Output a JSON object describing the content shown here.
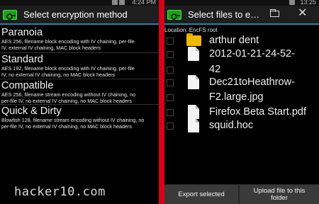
{
  "left": {
    "status_time": "4:24 PM",
    "title": "Select encryption method",
    "methods": [
      {
        "name": "Paranoia",
        "desc": [
          "AES 256, filename block encoding with IV chaining, per-file",
          "IV, external IV chaining, MAC block headers"
        ]
      },
      {
        "name": "Standard",
        "desc": [
          "AES 192, filename block encoding with IV chaining, per-file",
          "IV, no external IV chaining, no MAC block headers"
        ]
      },
      {
        "name": "Compatible",
        "desc": [
          "AES 256, filename stream encoding without IV chaining, no",
          "per-file IV, no external IV chaining, no MAC block headers"
        ]
      },
      {
        "name": "Quick & Dirty",
        "desc": [
          "Blowfish 128, filename stream encoding without IV chaining, no",
          "per-file IV, no external IV chaining, no MAC block headers"
        ]
      }
    ],
    "watermark": "hacker10.com"
  },
  "right": {
    "status_time": "13:25",
    "title": "Select files to e…",
    "location": "Location: EncFS root",
    "items": [
      {
        "name": "arthur dent",
        "type": "folder"
      },
      {
        "name": "2012-01-21-24-52-",
        "type": "file"
      },
      {
        "name": "42",
        "type": "none"
      },
      {
        "name": "Dec21toHeathrow-",
        "type": "file"
      },
      {
        "name": "F2.large.jpg",
        "type": "none"
      },
      {
        "name": "Firefox Beta Start.pdf",
        "type": "file"
      },
      {
        "name": "squid.hoc",
        "type": "file"
      }
    ],
    "buttons": {
      "export": "Export selected",
      "upload_line1": "Upload file to this",
      "upload_line2": "folder"
    }
  },
  "colors": {
    "accent": "#d8001a",
    "actionbar_line": "#2a7ea8",
    "folder": "#f2b800"
  },
  "icons": {
    "app": "key-icon",
    "new_folder": "folder-add-icon",
    "close": "close-icon"
  }
}
